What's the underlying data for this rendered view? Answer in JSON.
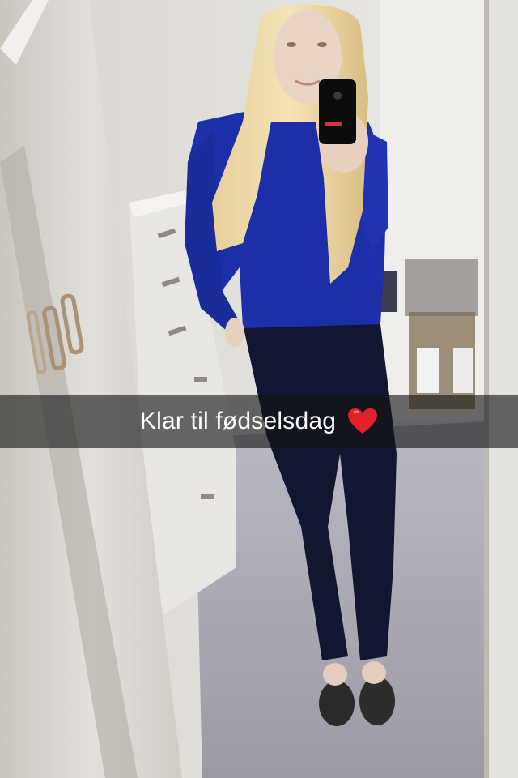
{
  "snap": {
    "caption": "Klar til fødselsdag",
    "emoji_icon": "red-heart-icon",
    "heart_color": "#e0202b"
  },
  "photo": {
    "subject": "mirror-selfie",
    "shirt_color": "#1c2fa8",
    "pants_color": "#121630"
  }
}
